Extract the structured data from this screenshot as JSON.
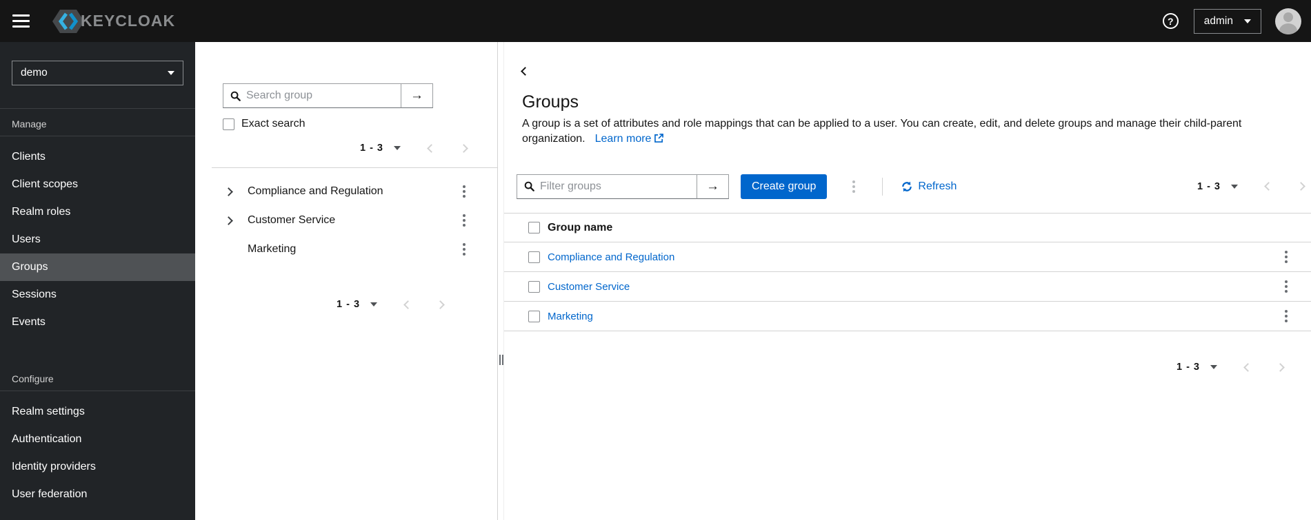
{
  "colors": {
    "primary": "#0066cc",
    "link": "#0066cc",
    "topbar_bg": "#151515",
    "sidebar_bg": "#212427",
    "sidebar_active_bg": "#4f5255",
    "border": "#d2d2d2",
    "logo_blue_light": "#35b1e2",
    "logo_blue_dark": "#1191cb"
  },
  "topbar": {
    "logo_text": "KEYCLOAK",
    "help_label": "?",
    "user_menu": "admin"
  },
  "sidebar": {
    "realm_selector": {
      "value": "demo"
    },
    "sections": [
      {
        "title": "Manage",
        "items": [
          {
            "label": "Clients"
          },
          {
            "label": "Client scopes"
          },
          {
            "label": "Realm roles"
          },
          {
            "label": "Users"
          },
          {
            "label": "Groups",
            "active": true
          },
          {
            "label": "Sessions"
          },
          {
            "label": "Events"
          }
        ]
      },
      {
        "title": "Configure",
        "items": [
          {
            "label": "Realm settings"
          },
          {
            "label": "Authentication"
          },
          {
            "label": "Identity providers"
          },
          {
            "label": "User federation"
          }
        ]
      }
    ]
  },
  "tree_panel": {
    "search": {
      "placeholder": "Search group"
    },
    "exact_search_label": "Exact search",
    "pagination_top": {
      "range": "1 - 3"
    },
    "groups": [
      {
        "name": "Compliance and Regulation",
        "expandable": true
      },
      {
        "name": "Customer Service",
        "expandable": true
      },
      {
        "name": "Marketing",
        "expandable": false
      }
    ],
    "pagination_bottom": {
      "range": "1 - 3"
    }
  },
  "main": {
    "title": "Groups",
    "description": "A group is a set of attributes and role mappings that can be applied to a user. You can create, edit, and delete groups and manage their child-parent organization.",
    "learn_more_label": "Learn more",
    "toolbar": {
      "filter_placeholder": "Filter groups",
      "create_button": "Create group",
      "refresh_label": "Refresh",
      "pagination": {
        "range": "1 - 3"
      }
    },
    "table": {
      "header": "Group name",
      "rows": [
        {
          "name": "Compliance and Regulation"
        },
        {
          "name": "Customer Service"
        },
        {
          "name": "Marketing"
        }
      ]
    },
    "pagination_bottom": {
      "range": "1 - 3"
    }
  }
}
